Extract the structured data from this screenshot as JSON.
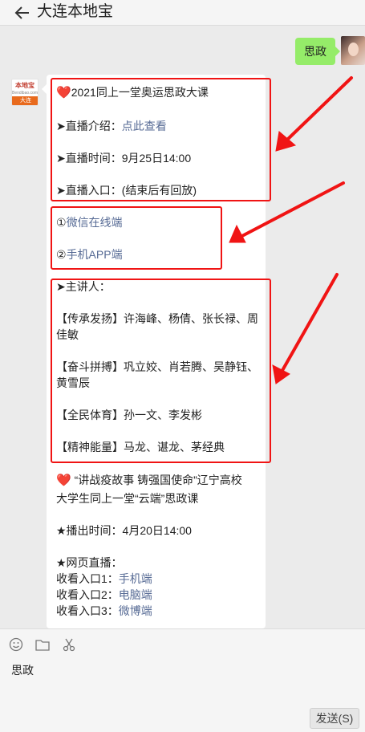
{
  "header": {
    "title": "大连本地宝"
  },
  "chat": {
    "my_message": "思政",
    "bot_avatar": {
      "logo": "本地宝",
      "sub": "Bendibao.com",
      "tag": "大连"
    },
    "reply": {
      "heart_glyph": "❤️",
      "pointer_glyph": "➤",
      "title": "2021同上一堂奥运思政大课",
      "intro_label": "直播介绍：",
      "intro_link": "点此查看",
      "time_label": "直播时间：",
      "time_value": "9月25日14:00",
      "entry_label": "直播入口：(结束后有回放)",
      "option_1": "①",
      "option_1_link": "微信在线端",
      "option_2": "②",
      "option_2_link": "手机APP端",
      "speaker_label": "主讲人：",
      "group1_line1": "【传承发扬】许海峰、杨倩、张长禄、周",
      "group1_line2": "佳敏",
      "group2_line1": "【奋斗拼搏】巩立姣、肖若腾、吴静钰、",
      "group2_line2": "黄雪辰",
      "group3": "【全民体育】孙一文、李发彬",
      "group4": "【精神能量】马龙、谌龙、茅经典",
      "course_line1": " “讲战疫故事 铸强国使命”辽宁高校",
      "course_line2": "大学生同上一堂“云端”思政课",
      "broadcast_time": "★播出时间：4月20日14:00",
      "web_live": "★网页直播：",
      "entrance_1_label": "收看入口1：",
      "entrance_1_link": "手机端",
      "entrance_2_label": "收看入口2：",
      "entrance_2_link": "电脑端",
      "entrance_3_label": "收看入口3：",
      "entrance_3_link": "微博端"
    }
  },
  "input": {
    "text": "思政",
    "send_label": "发送(S)"
  },
  "colors": {
    "annotation": "#f01414",
    "link": "#576b95",
    "bubble_me": "#95ec69"
  }
}
